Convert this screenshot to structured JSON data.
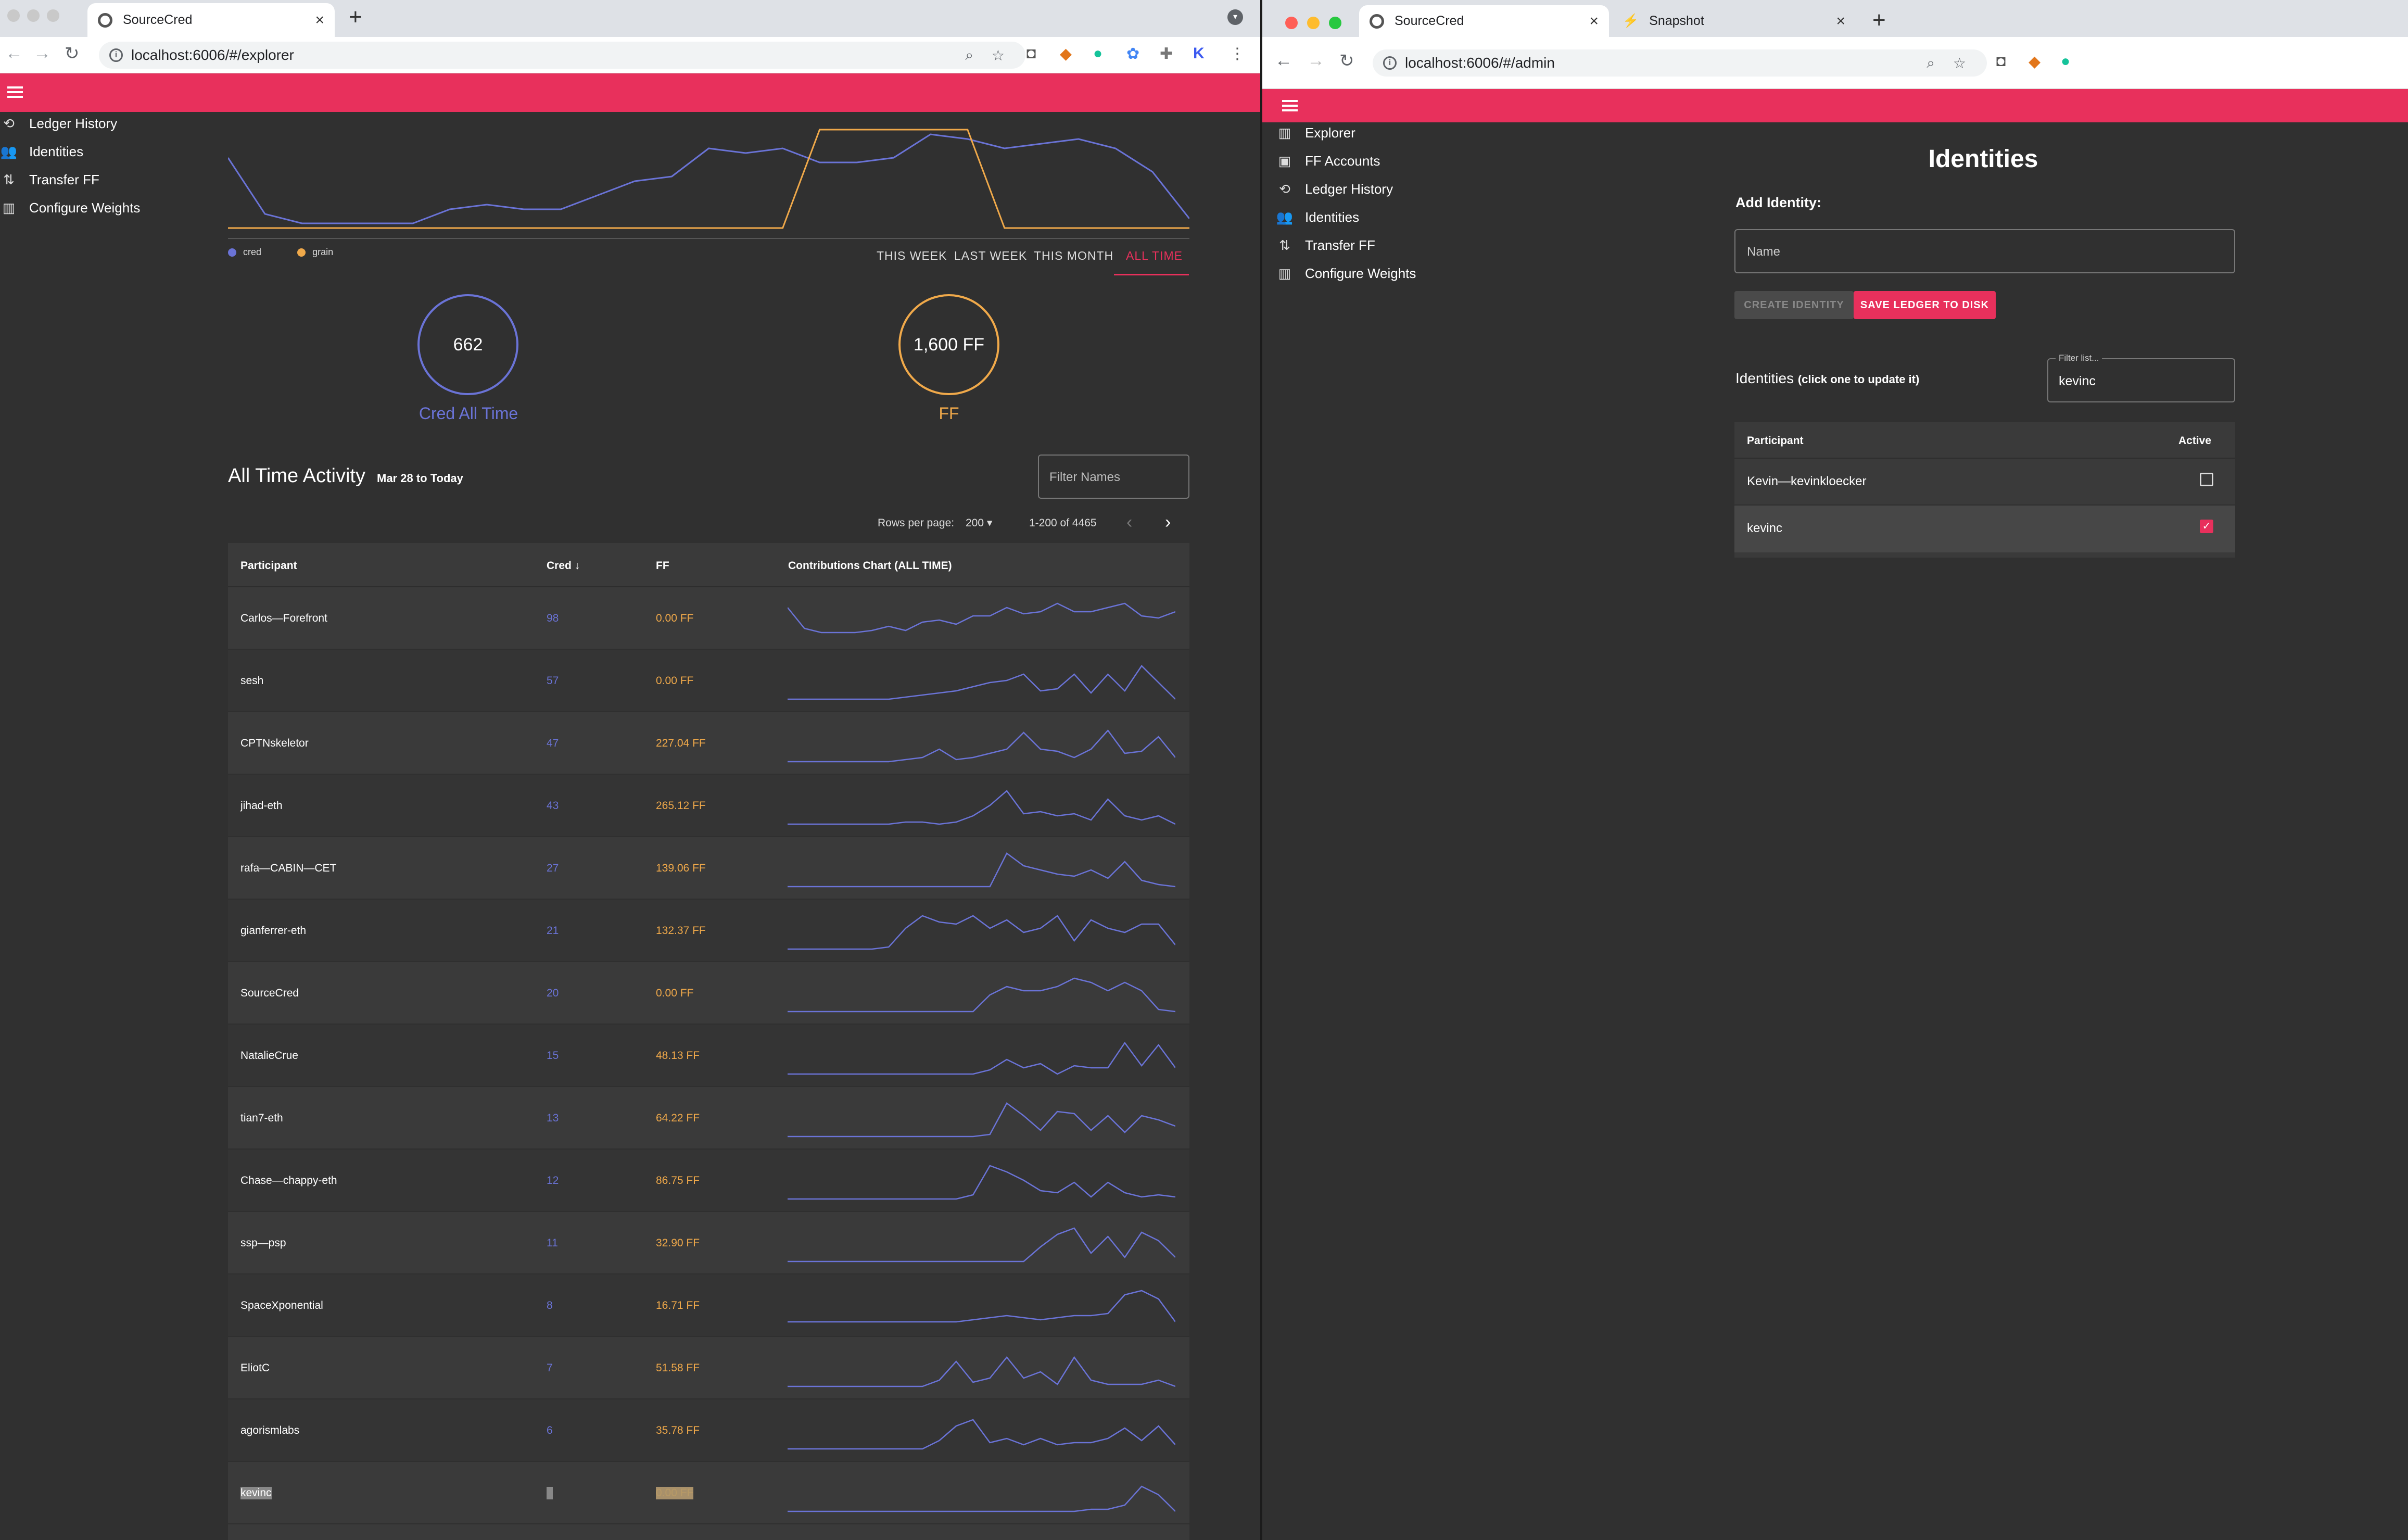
{
  "left_window": {
    "tab_title": "SourceCred",
    "url": "localhost:6006/#/explorer",
    "sidebar": [
      {
        "icon": "history-icon",
        "label": "Ledger History"
      },
      {
        "icon": "people-icon",
        "label": "Identities"
      },
      {
        "icon": "transfer-icon",
        "label": "Transfer FF"
      },
      {
        "icon": "bar-chart-icon",
        "label": "Configure Weights"
      }
    ],
    "legend": {
      "cred": "cred",
      "grain": "grain"
    },
    "time_tabs": [
      "THIS WEEK",
      "LAST WEEK",
      "THIS MONTH",
      "ALL TIME"
    ],
    "active_time_tab": "ALL TIME",
    "cred_total": "662",
    "cred_label": "Cred All Time",
    "ff_total": "1,600 FF",
    "ff_label": "FF",
    "activity_title": "All Time Activity",
    "activity_range": "Mar 28 to Today",
    "filter_placeholder": "Filter Names",
    "rows_per_page_label": "Rows per page:",
    "rows_per_page": "200",
    "pagination": "1-200 of 4465",
    "columns": {
      "participant": "Participant",
      "cred": "Cred",
      "ff": "FF",
      "chart": "Contributions Chart (ALL TIME)"
    },
    "rows": [
      {
        "name": "Carlos—Forefront",
        "cred": "98",
        "ff": "0.00 FF",
        "spark": [
          14,
          4,
          2,
          2,
          2,
          3,
          5,
          3,
          7,
          8,
          6,
          10,
          10,
          14,
          11,
          12,
          16,
          12,
          12,
          14,
          16,
          10,
          9,
          12
        ]
      },
      {
        "name": "sesh",
        "cred": "57",
        "ff": "0.00 FF",
        "spark": [
          0,
          0,
          0,
          0,
          0,
          0,
          0,
          1,
          2,
          3,
          4,
          6,
          8,
          9,
          12,
          4,
          5,
          12,
          3,
          12,
          4,
          16,
          8,
          0
        ]
      },
      {
        "name": "CPTNskeletor",
        "cred": "47",
        "ff": "227.04 FF",
        "spark": [
          0,
          0,
          0,
          0,
          0,
          0,
          0,
          1,
          2,
          6,
          1,
          2,
          4,
          6,
          14,
          6,
          5,
          2,
          6,
          15,
          4,
          5,
          12,
          2
        ]
      },
      {
        "name": "jihad-eth",
        "cred": "43",
        "ff": "265.12 FF",
        "spark": [
          0,
          0,
          0,
          0,
          0,
          0,
          0,
          1,
          1,
          0,
          1,
          4,
          9,
          16,
          5,
          6,
          4,
          5,
          2,
          12,
          4,
          2,
          4,
          0
        ]
      },
      {
        "name": "rafa—CABIN—CET",
        "cred": "27",
        "ff": "139.06 FF",
        "spark": [
          0,
          0,
          0,
          0,
          0,
          0,
          0,
          0,
          0,
          0,
          0,
          0,
          0,
          16,
          10,
          8,
          6,
          5,
          8,
          4,
          12,
          3,
          1,
          0
        ]
      },
      {
        "name": "gianferrer-eth",
        "cred": "21",
        "ff": "132.37 FF",
        "spark": [
          0,
          0,
          0,
          0,
          0,
          0,
          1,
          10,
          16,
          13,
          12,
          16,
          10,
          14,
          8,
          10,
          16,
          4,
          14,
          10,
          8,
          12,
          12,
          2
        ]
      },
      {
        "name": "SourceCred",
        "cred": "20",
        "ff": "0.00 FF",
        "spark": [
          0,
          0,
          0,
          0,
          0,
          0,
          0,
          0,
          0,
          0,
          0,
          0,
          8,
          12,
          10,
          10,
          12,
          16,
          14,
          10,
          14,
          10,
          1,
          0
        ]
      },
      {
        "name": "NatalieCrue",
        "cred": "15",
        "ff": "48.13 FF",
        "spark": [
          0,
          0,
          0,
          0,
          0,
          0,
          0,
          0,
          0,
          0,
          0,
          0,
          2,
          7,
          3,
          5,
          0,
          4,
          3,
          3,
          15,
          4,
          14,
          3
        ]
      },
      {
        "name": "tian7-eth",
        "cred": "13",
        "ff": "64.22 FF",
        "spark": [
          0,
          0,
          0,
          0,
          0,
          0,
          0,
          0,
          0,
          0,
          0,
          0,
          1,
          16,
          10,
          3,
          12,
          11,
          3,
          10,
          2,
          10,
          8,
          5
        ]
      },
      {
        "name": "Chase—chappy-eth",
        "cred": "12",
        "ff": "86.75 FF",
        "spark": [
          0,
          0,
          0,
          0,
          0,
          0,
          0,
          0,
          0,
          0,
          0,
          2,
          16,
          13,
          9,
          4,
          3,
          8,
          1,
          8,
          3,
          1,
          2,
          1
        ]
      },
      {
        "name": "ssp—psp",
        "cred": "11",
        "ff": "32.90 FF",
        "spark": [
          0,
          0,
          0,
          0,
          0,
          0,
          0,
          0,
          0,
          0,
          0,
          0,
          0,
          0,
          0,
          7,
          13,
          16,
          4,
          12,
          2,
          14,
          10,
          2
        ]
      },
      {
        "name": "SpaceXponential",
        "cred": "8",
        "ff": "16.71 FF",
        "spark": [
          1,
          1,
          1,
          1,
          1,
          1,
          1,
          1,
          1,
          1,
          1,
          2,
          3,
          4,
          3,
          2,
          3,
          4,
          4,
          5,
          14,
          16,
          12,
          1
        ]
      },
      {
        "name": "EliotC",
        "cred": "7",
        "ff": "51.58 FF",
        "spark": [
          0,
          0,
          0,
          0,
          0,
          0,
          0,
          0,
          0,
          3,
          12,
          2,
          4,
          14,
          4,
          7,
          1,
          14,
          3,
          1,
          1,
          1,
          3,
          0
        ]
      },
      {
        "name": "agorismlabs",
        "cred": "6",
        "ff": "35.78 FF",
        "spark": [
          0,
          0,
          0,
          0,
          0,
          0,
          0,
          0,
          0,
          4,
          11,
          14,
          3,
          5,
          2,
          5,
          2,
          3,
          3,
          5,
          10,
          4,
          11,
          2
        ]
      },
      {
        "name": "kevinc",
        "cred": "1",
        "ff": "0.00 FF",
        "spark": [
          0,
          0,
          0,
          0,
          0,
          0,
          0,
          0,
          0,
          0,
          0,
          0,
          0,
          0,
          0,
          0,
          0,
          0,
          1,
          1,
          3,
          12,
          8,
          0
        ]
      }
    ]
  },
  "right_window": {
    "tab_title": "SourceCred",
    "tab2_title": "Snapshot",
    "url": "localhost:6006/#/admin",
    "sidebar": [
      {
        "icon": "bar-chart-icon",
        "label": "Explorer"
      },
      {
        "icon": "wallet-icon",
        "label": "FF Accounts"
      },
      {
        "icon": "history-icon",
        "label": "Ledger History"
      },
      {
        "icon": "people-icon",
        "label": "Identities"
      },
      {
        "icon": "transfer-icon",
        "label": "Transfer FF"
      },
      {
        "icon": "bar-chart-icon",
        "label": "Configure Weights"
      }
    ],
    "page_title": "Identities",
    "add_identity_label": "Add Identity:",
    "name_placeholder": "Name",
    "create_button": "CREATE IDENTITY",
    "save_button": "SAVE LEDGER TO DISK",
    "identities_heading": "Identities",
    "identities_hint": "(click one to update it)",
    "filter_label": "Filter list...",
    "filter_value": "kevinc",
    "columns": {
      "participant": "Participant",
      "active": "Active"
    },
    "rows": [
      {
        "name": "Kevin—kevinkloecker",
        "active": false
      },
      {
        "name": "kevinc",
        "active": true
      }
    ]
  },
  "colors": {
    "accent": "#e8305c",
    "cred": "#6a73d6",
    "grain": "#f0a94a"
  },
  "chart_data": {
    "type": "line",
    "series": [
      {
        "name": "cred",
        "values": [
          15,
          3,
          1,
          1,
          1,
          1,
          4,
          5,
          4,
          4,
          7,
          10,
          11,
          17,
          16,
          17,
          14,
          14,
          15,
          20,
          19,
          17,
          18,
          19,
          17,
          12,
          2
        ]
      },
      {
        "name": "grain",
        "values": [
          0,
          0,
          0,
          0,
          0,
          0,
          0,
          0,
          0,
          0,
          0,
          0,
          0,
          0,
          0,
          0,
          21,
          21,
          21,
          21,
          21,
          0,
          0,
          0,
          0,
          0,
          0
        ]
      }
    ],
    "legend": [
      "cred",
      "grain"
    ]
  }
}
